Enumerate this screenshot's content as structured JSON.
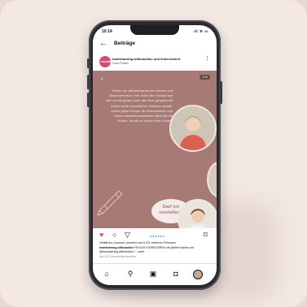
{
  "status_bar": {
    "time": "10:14",
    "icons": "ıll ᯤ ▭"
  },
  "top_bar": {
    "back_icon": "arrow-left-icon",
    "title": "Beiträge"
  },
  "post": {
    "avatar_label": "ZUSAMMEN",
    "authors": "learnlearning.withcaroline und linlert.kariert",
    "subtitle": "Coco Pohler",
    "page_counter": "1/10",
    "quote_mark": "“",
    "body_text": "Sowie von @linlert.kariert ist Lehrerin und Wundermensch. Ihre Texte über Schule und das Lernen gehen unter die Haut, gespickt mit einem schier unendlichen Wissens-schatz, einem guten Gespür für Zwischentöne und einem bedürfnisorientierten Blick auf die Schule, die sie an echten Ines Schatz.",
    "bubble_text": "Darf ich vorstellen?",
    "likes": "Gefällt the_focused_moment und 6.231 weiteren Personen",
    "caption_user": "learnlearning.withcaroline",
    "caption_text": "FEHLER KORRIGIEREN mit @linlert.kariert und @learnlearning.withcaroline !... mehr",
    "comments_link": "Alle 231 Kommentare ansehen"
  },
  "actions": {
    "like_icon": "heart-icon",
    "comment_icon": "comment-icon",
    "share_icon": "send-icon",
    "save_icon": "bookmark-icon",
    "carousel_dots": "●●●●●●"
  },
  "bottom_nav": {
    "items": [
      "home-icon",
      "search-icon",
      "shop-icon",
      "bag-icon",
      "profile-avatar"
    ]
  },
  "colors": {
    "post_background": "#a77a76",
    "like_red": "#ed4956",
    "dot_blue": "#3897f0"
  }
}
